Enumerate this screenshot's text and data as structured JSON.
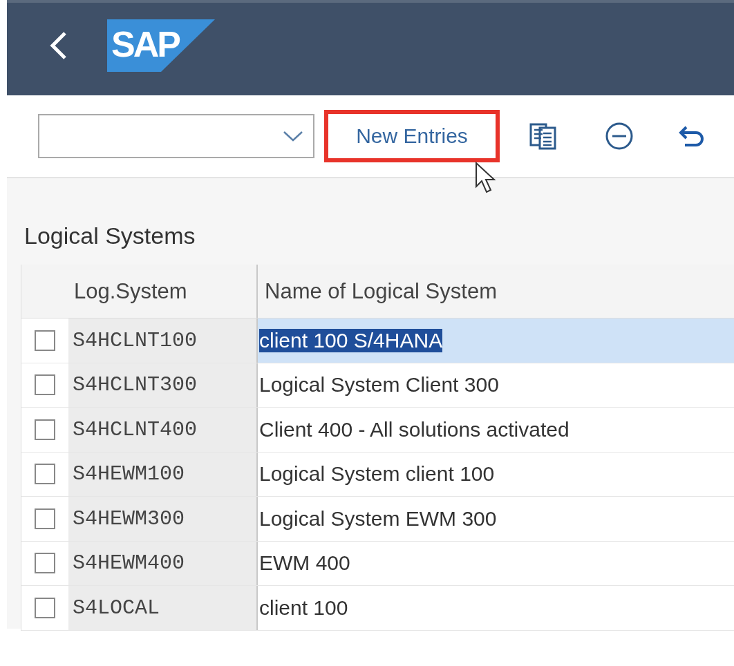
{
  "header": {
    "logo": "SAP"
  },
  "toolbar": {
    "new_entries": {
      "label": "New Entries",
      "highlighted": true
    }
  },
  "section_title": "Logical Systems",
  "table": {
    "columns": [
      "Log.System",
      "Name of Logical System"
    ],
    "rows": [
      {
        "system": "S4HCLNT100",
        "name": "client 100 S/4HANA",
        "checked": false,
        "selected": true
      },
      {
        "system": "S4HCLNT300",
        "name": "Logical System Client 300",
        "checked": false,
        "selected": false
      },
      {
        "system": "S4HCLNT400",
        "name": "Client 400 - All solutions activated",
        "checked": false,
        "selected": false
      },
      {
        "system": "S4HEWM100",
        "name": "Logical System client 100",
        "checked": false,
        "selected": false
      },
      {
        "system": "S4HEWM300",
        "name": "Logical System EWM 300",
        "checked": false,
        "selected": false
      },
      {
        "system": "S4HEWM400",
        "name": "EWM 400",
        "checked": false,
        "selected": false
      },
      {
        "system": "S4LOCAL",
        "name": "client 100",
        "checked": false,
        "selected": false
      }
    ]
  }
}
